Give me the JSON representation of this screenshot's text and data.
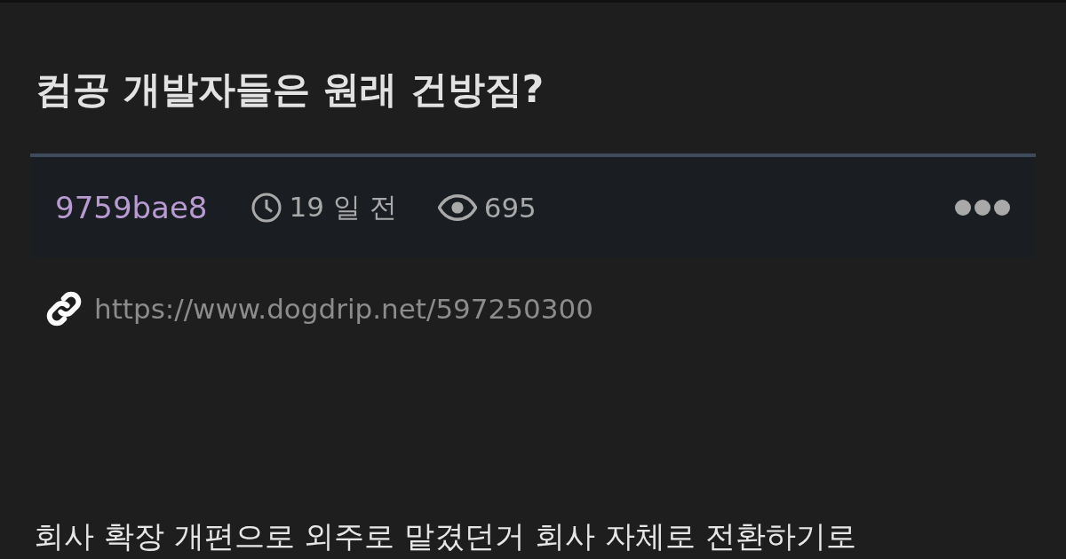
{
  "post": {
    "title": "컴공 개발자들은 원래 건방짐?",
    "author": "9759bae8",
    "time": "19 일 전",
    "views": "695",
    "url": "https://www.dogdrip.net/597250300",
    "body": "회사 확장 개편으로 외주로 맡겼던거 회사 자체로 전환하기로"
  }
}
